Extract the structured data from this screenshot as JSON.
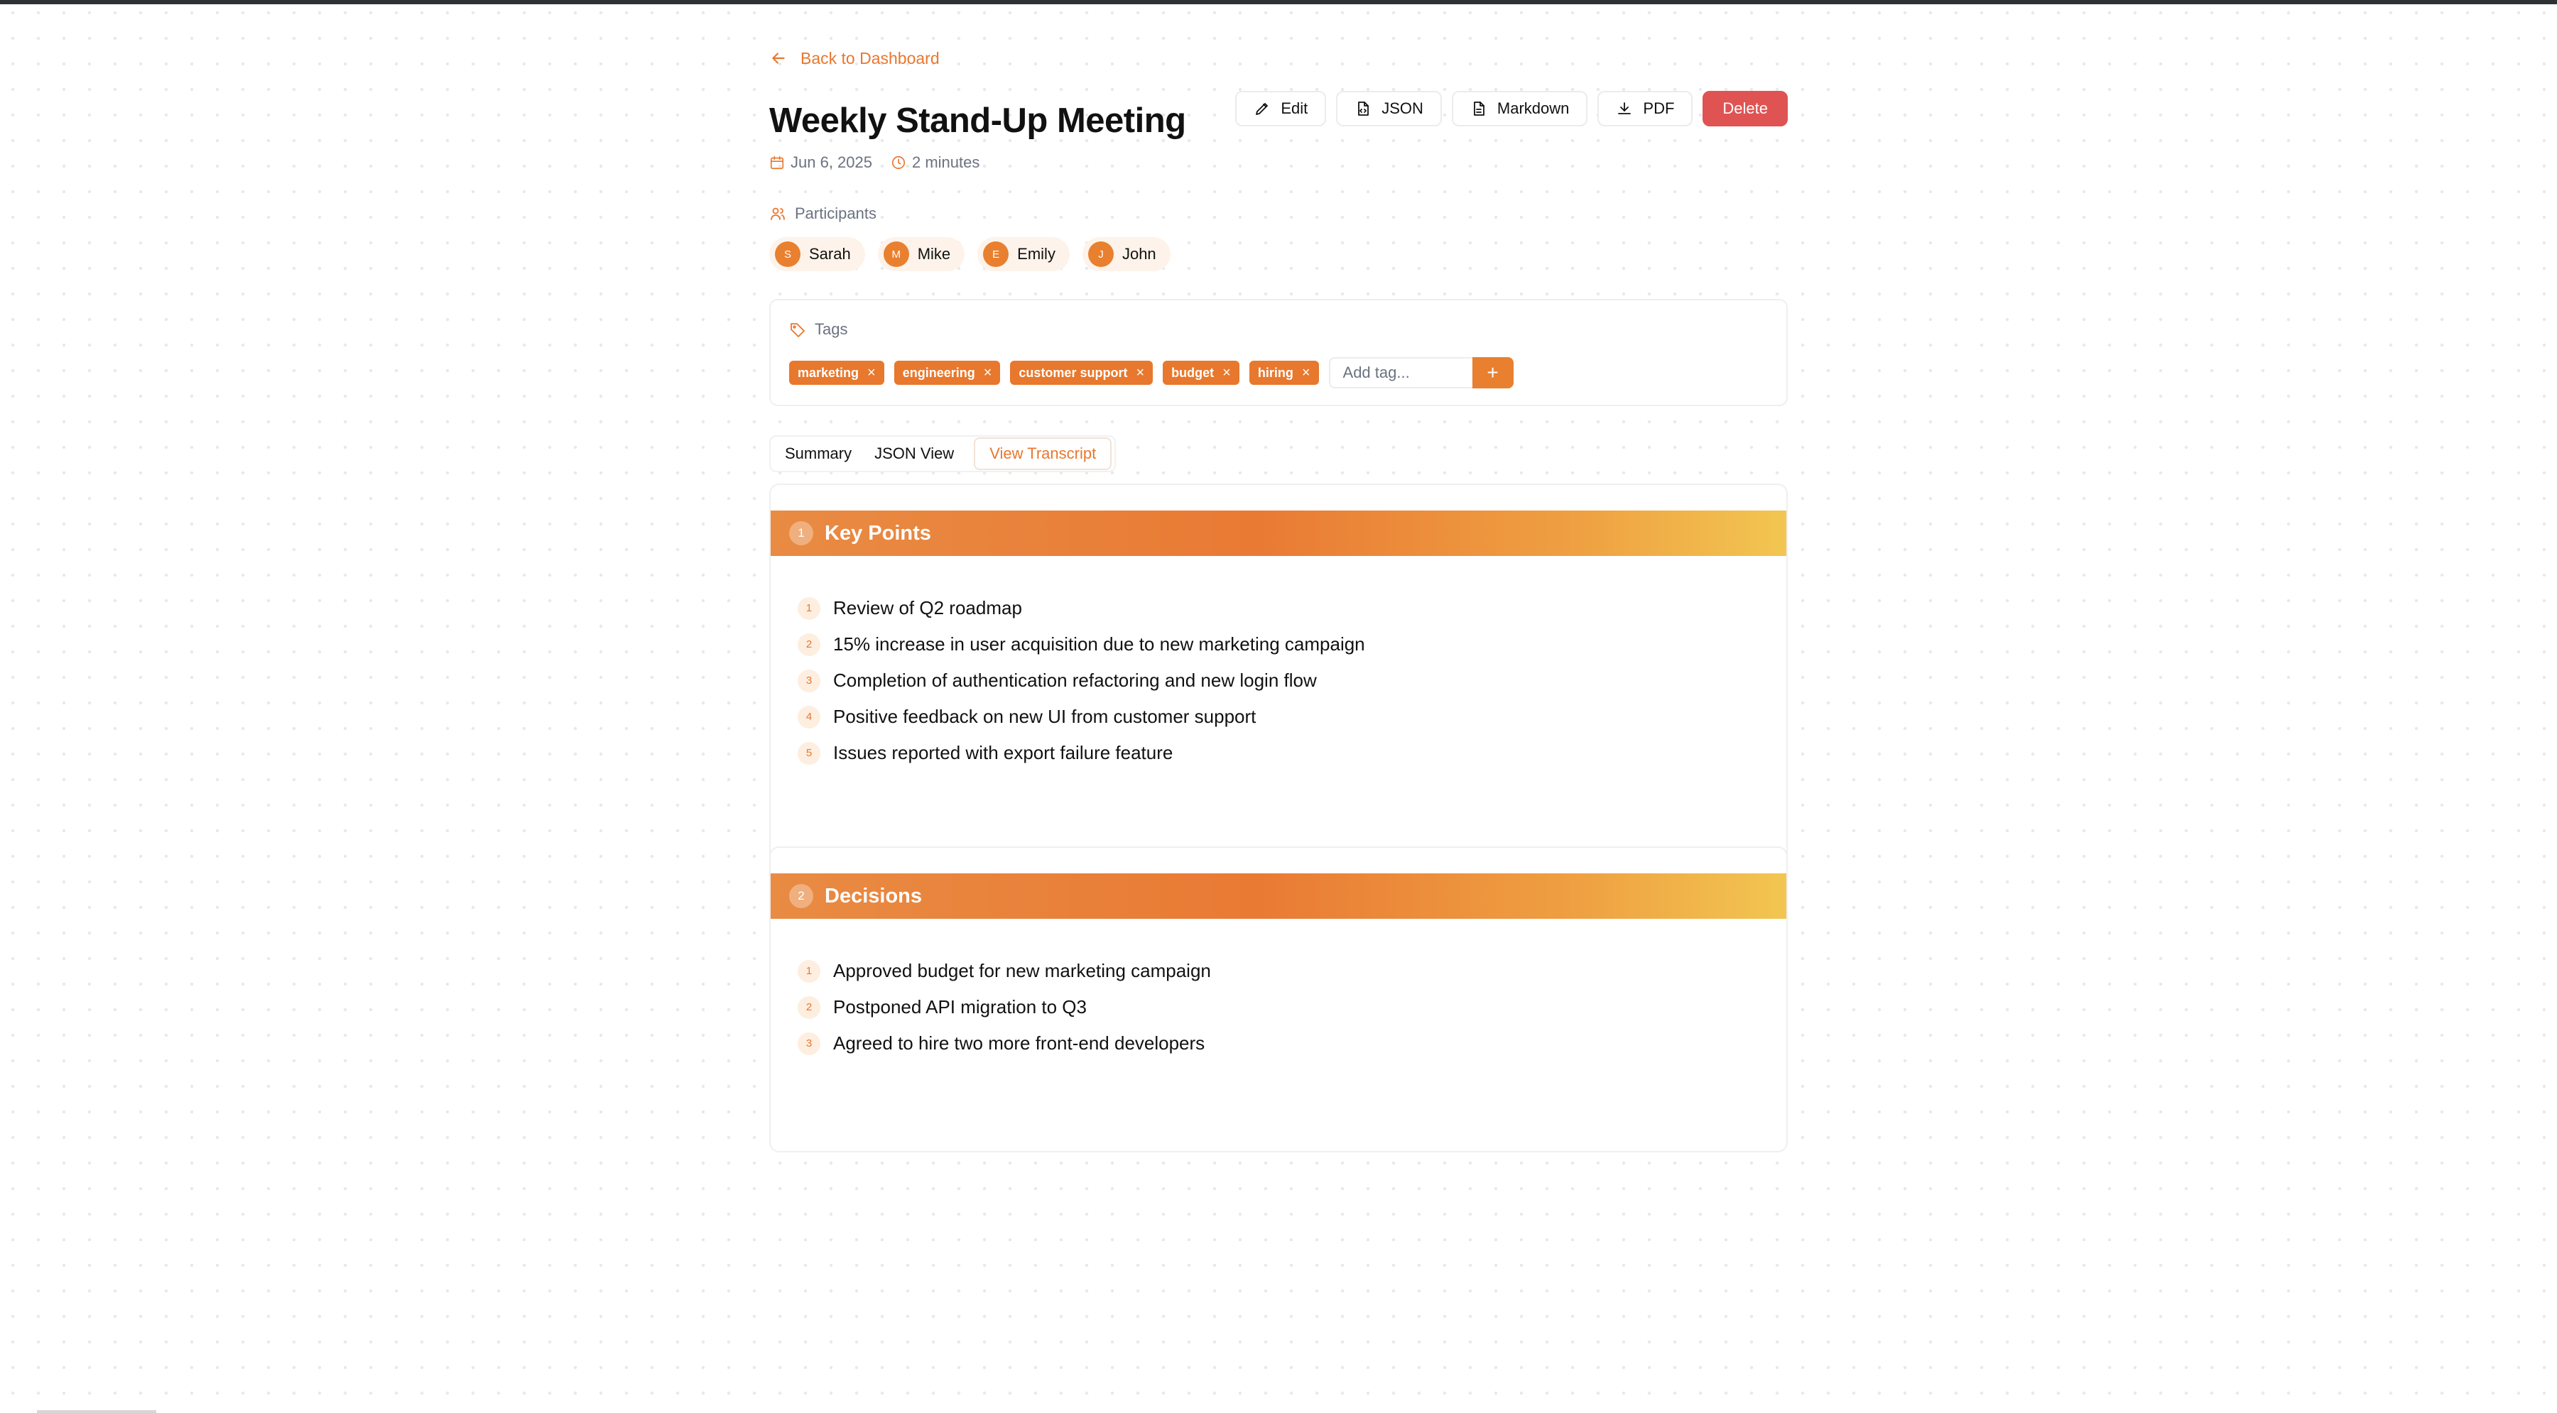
{
  "nav": {
    "back_label": "Back to Dashboard"
  },
  "meeting": {
    "title": "Weekly Stand-Up Meeting",
    "date": "Jun 6, 2025",
    "duration": "2 minutes"
  },
  "actions": {
    "edit": "Edit",
    "json": "JSON",
    "markdown": "Markdown",
    "pdf": "PDF",
    "delete": "Delete"
  },
  "participants": {
    "label": "Participants",
    "people": [
      {
        "initial": "S",
        "name": "Sarah"
      },
      {
        "initial": "M",
        "name": "Mike"
      },
      {
        "initial": "E",
        "name": "Emily"
      },
      {
        "initial": "J",
        "name": "John"
      }
    ]
  },
  "tags": {
    "label": "Tags",
    "items": [
      "marketing",
      "engineering",
      "customer support",
      "budget",
      "hiring"
    ],
    "remove_glyph": "×",
    "placeholder": "Add tag...",
    "add_glyph": "+"
  },
  "tabs": [
    {
      "label": "Summary"
    },
    {
      "label": "JSON View"
    },
    {
      "label": "View Transcript",
      "active": true
    }
  ],
  "sections": {
    "key_points": {
      "number": "1",
      "title": "Key Points",
      "items": [
        {
          "n": "1",
          "text": "Review of Q2 roadmap"
        },
        {
          "n": "2",
          "text": "15% increase in user acquisition due to new marketing campaign"
        },
        {
          "n": "3",
          "text": "Completion of authentication refactoring and new login flow"
        },
        {
          "n": "4",
          "text": "Positive feedback on new UI from customer support"
        },
        {
          "n": "5",
          "text": "Issues reported with export failure feature"
        }
      ]
    },
    "decisions": {
      "number": "2",
      "title": "Decisions",
      "items": [
        {
          "n": "1",
          "text": "Approved budget for new marketing campaign"
        },
        {
          "n": "2",
          "text": "Postponed API migration to Q3"
        },
        {
          "n": "3",
          "text": "Agreed to hire two more front-end developers"
        }
      ]
    }
  },
  "colors": {
    "accent": "#e8772e",
    "danger": "#e05353",
    "gradient_end": "#f2c651"
  }
}
